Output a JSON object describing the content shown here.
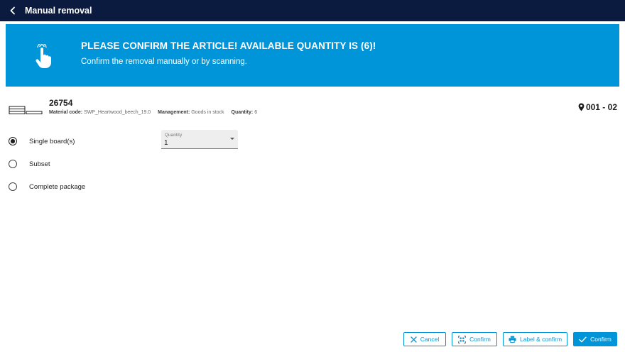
{
  "header": {
    "title": "Manual removal"
  },
  "banner": {
    "title": "PLEASE CONFIRM THE ARTICLE! AVAILABLE QUANTITY IS (6)!",
    "subtitle": "Confirm the removal manually or by scanning."
  },
  "article": {
    "id": "26754",
    "material_code_label": "Material code:",
    "material_code": "SWP_Heartwood_beech_19.0",
    "management_label": "Management:",
    "management": "Goods in stock",
    "quantity_label": "Quantity:",
    "quantity": "6",
    "location": "001 - 02"
  },
  "options": [
    {
      "label": "Single board(s)",
      "checked": true
    },
    {
      "label": "Subset",
      "checked": false
    },
    {
      "label": "Complete package",
      "checked": false
    }
  ],
  "quantity_select": {
    "label": "Quantity",
    "value": "1"
  },
  "buttons": {
    "cancel": "Cancel",
    "scan_confirm": "Confirm",
    "label_confirm": "Label & confirm",
    "confirm": "Confirm"
  },
  "colors": {
    "header_bg": "#0b1b3f",
    "accent": "#0095d9"
  },
  "icons": {
    "back": "chevron-left-icon",
    "banner": "hand-pointer-icon",
    "article": "boards-icon",
    "location": "map-pin-icon",
    "cancel": "close-icon",
    "scan": "qr-scan-icon",
    "print": "printer-icon",
    "confirm": "check-icon"
  }
}
